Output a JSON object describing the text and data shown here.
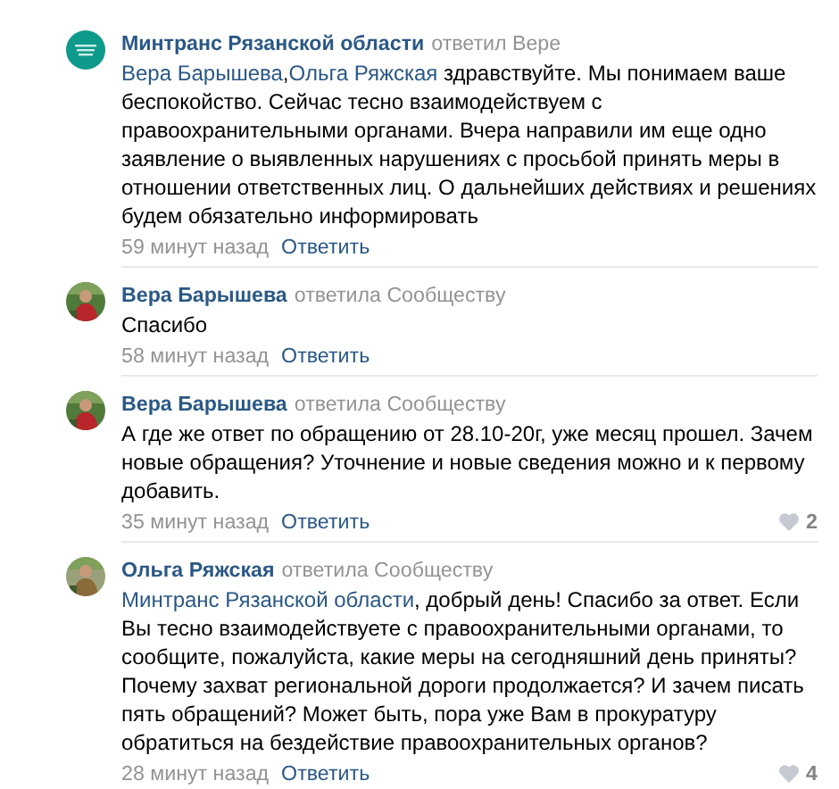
{
  "comments": [
    {
      "author": "Минтранс Рязанской области",
      "action": "ответил Вере",
      "kind": "community",
      "body": [
        {
          "kind": "mention",
          "text": "Вера Барышева"
        },
        {
          "kind": "text",
          "text": ","
        },
        {
          "kind": "mention",
          "text": "Ольга Ряжская"
        },
        {
          "kind": "text",
          "text": " здравствуйте. Мы понимаем ваше беспокойство. Сейчас тесно взаимодействуем с правоохранительными органами. Вчера направили им еще одно заявление о выявленных нарушениях с просьбой принять меры в отношении ответственных лиц. О дальнейших действиях и решениях будем обязательно информировать"
        }
      ],
      "time": "59 минут назад",
      "reply": "Ответить"
    },
    {
      "author": "Вера Барышева",
      "action": "ответила Сообществу",
      "kind": "user",
      "body": [
        {
          "kind": "text",
          "text": "Спасибо"
        }
      ],
      "time": "58 минут назад",
      "reply": "Ответить"
    },
    {
      "author": "Вера Барышева",
      "action": "ответила Сообществу",
      "kind": "user",
      "body": [
        {
          "kind": "text",
          "text": "А где же ответ по обращению от 28.10-20г, уже месяц прошел. Зачем новые обращения? Уточнение и новые сведения можно и к первому добавить."
        }
      ],
      "time": "35 минут назад",
      "reply": "Ответить",
      "likes": "2"
    },
    {
      "author": "Ольга Ряжская",
      "action": "ответила Сообществу",
      "kind": "user",
      "body": [
        {
          "kind": "mention",
          "text": "Минтранс Рязанской области"
        },
        {
          "kind": "text",
          "text": ", добрый день! Спасибо за ответ. Если Вы тесно взаимодействуете с правоохранительными органами, то сообщите, пожалуйста, какие меры на сегодняшний день приняты? Почему захват региональной дороги продолжается? И зачем писать пять обращений? Может быть, пора уже Вам в прокуратуру обратиться на бездействие правоохранительных органов?"
        }
      ],
      "time": "28 минут назад",
      "reply": "Ответить",
      "likes": "4"
    }
  ]
}
